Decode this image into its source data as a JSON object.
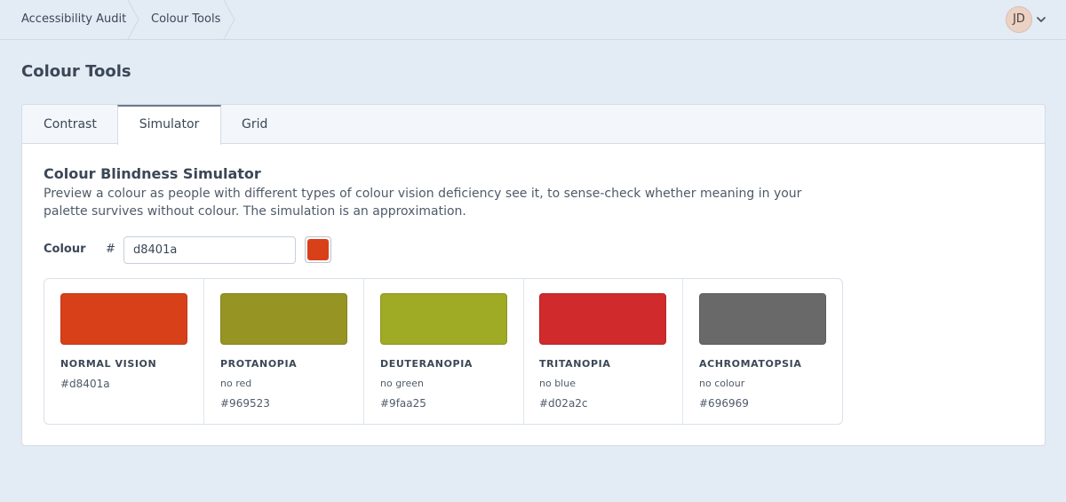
{
  "breadcrumb": {
    "items": [
      "Accessibility Audit",
      "Colour Tools"
    ]
  },
  "user": {
    "initials": "JD"
  },
  "page": {
    "title": "Colour Tools"
  },
  "tabs": [
    {
      "label": "Contrast",
      "active": false
    },
    {
      "label": "Simulator",
      "active": true
    },
    {
      "label": "Grid",
      "active": false
    }
  ],
  "simulator": {
    "title": "Colour Blindness Simulator",
    "description": "Preview a colour as people with different types of colour vision deficiency see it, to sense-check whether meaning in your palette survives without colour. The simulation is an approximation.",
    "colour_label": "Colour",
    "hash": "#",
    "hex_value": "d8401a",
    "swatch_color": "#d8401a",
    "results": [
      {
        "name": "NORMAL VISION",
        "sub": "",
        "hex": "#d8401a",
        "color": "#d8401a"
      },
      {
        "name": "PROTANOPIA",
        "sub": "no red",
        "hex": "#969523",
        "color": "#969523"
      },
      {
        "name": "DEUTERANOPIA",
        "sub": "no green",
        "hex": "#9faa25",
        "color": "#9faa25"
      },
      {
        "name": "TRITANOPIA",
        "sub": "no blue",
        "hex": "#d02a2c",
        "color": "#d02a2c"
      },
      {
        "name": "ACHROMATOPSIA",
        "sub": "no colour",
        "hex": "#696969",
        "color": "#696969"
      }
    ]
  }
}
